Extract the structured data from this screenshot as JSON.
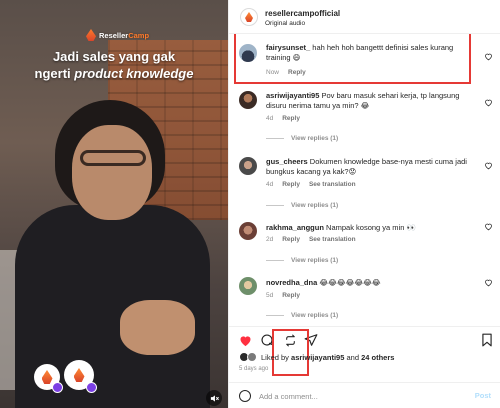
{
  "video": {
    "brand_name_part1": "Reseller",
    "brand_name_part2": "Camp",
    "caption_line1": "Jadi sales yang gak",
    "caption_line2_prefix": "ngerti ",
    "caption_line2_emphasis": "product knowledge"
  },
  "header": {
    "username": "resellercampofficial",
    "audio": "Original audio"
  },
  "comments": [
    {
      "username": "fairysunset_",
      "text": " hah heh hoh bangettt definisi sales kurang training 😄",
      "time": "Now",
      "reply_label": "Reply",
      "highlighted": true
    },
    {
      "username": "asriwijayanti95",
      "text": " Pov baru masuk sehari kerja, tp langsung disuru nerima tamu ya min? 😂",
      "time": "4d",
      "reply_label": "Reply",
      "view_replies": "View replies (1)"
    },
    {
      "username": "gus_cheers",
      "text": " Dokumen knowledge base-nya mesti cuma jadi bungkus kacang ya kak?😟",
      "time": "4d",
      "reply_label": "Reply",
      "translation_label": "See translation",
      "view_replies": "View replies (1)"
    },
    {
      "username": "rakhma_anggun",
      "text": " Nampak kosong ya min 👀",
      "time": "2d",
      "reply_label": "Reply",
      "translation_label": "See translation",
      "view_replies": "View replies (1)"
    },
    {
      "username": "novredha_dna",
      "text": " 😂😂😂😂😂😂😂",
      "time": "5d",
      "reply_label": "Reply",
      "view_replies": "View replies (1)"
    }
  ],
  "likes": {
    "prefix": "Liked by ",
    "user": "asriwijayanti95",
    "and": " and ",
    "others": "24 others"
  },
  "posted_ago": "5 days ago",
  "add_comment": {
    "placeholder": "Add a comment...",
    "post_label": "Post"
  },
  "colors": {
    "highlight": "#e53935",
    "like_red": "#ff3040",
    "post_disabled": "#b2dffc"
  },
  "icons": [
    "heart-icon",
    "comment-icon",
    "repost-icon",
    "share-icon",
    "bookmark-icon",
    "emoji-icon",
    "mute-icon"
  ]
}
